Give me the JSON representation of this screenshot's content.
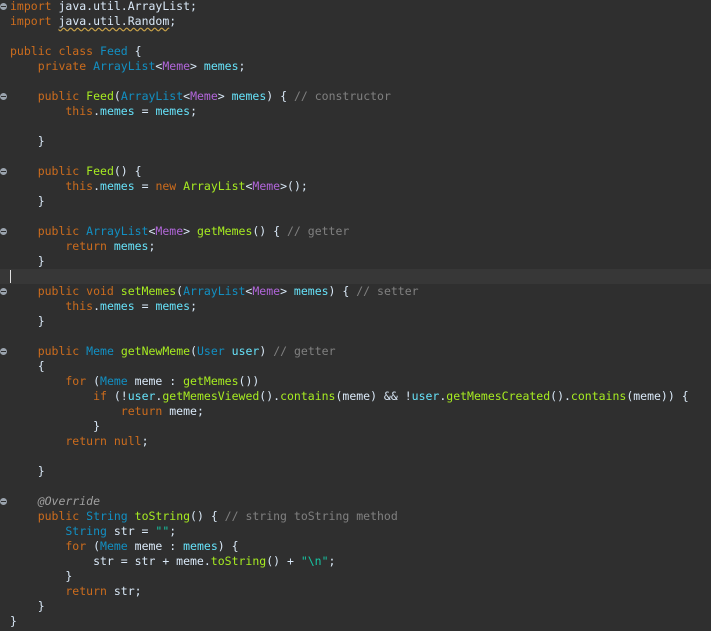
{
  "editor": {
    "language": "java",
    "colors": {
      "background": "#2f2f2f",
      "keyword": "#cc6c1d",
      "class": "#1290c3",
      "generic": "#b166da",
      "method": "#a7ec21",
      "field": "#66e1f8",
      "comment": "#808080",
      "string": "#17c6a3",
      "plain": "#d9e8f7"
    },
    "lines": [
      [
        {
          "t": "import",
          "c": "kw"
        },
        {
          "t": " java.util.ArrayList;",
          "c": "pl"
        }
      ],
      [
        {
          "t": "import",
          "c": "kw"
        },
        {
          "t": " ",
          "c": "pl"
        },
        {
          "t": "java.util.Random",
          "c": "pl squig"
        },
        {
          "t": ";",
          "c": "pl"
        }
      ],
      [],
      [
        {
          "t": "public class ",
          "c": "kw"
        },
        {
          "t": "Feed",
          "c": "cls"
        },
        {
          "t": " {",
          "c": "pl"
        }
      ],
      [
        {
          "t": "    private ",
          "c": "kw"
        },
        {
          "t": "ArrayList",
          "c": "cls"
        },
        {
          "t": "<",
          "c": "pl"
        },
        {
          "t": "Meme",
          "c": "gen"
        },
        {
          "t": "> ",
          "c": "pl"
        },
        {
          "t": "memes",
          "c": "fld"
        },
        {
          "t": ";",
          "c": "pl"
        }
      ],
      [],
      [
        {
          "t": "    public ",
          "c": "kw"
        },
        {
          "t": "Feed",
          "c": "mth"
        },
        {
          "t": "(",
          "c": "pl"
        },
        {
          "t": "ArrayList",
          "c": "cls"
        },
        {
          "t": "<",
          "c": "pl"
        },
        {
          "t": "Meme",
          "c": "gen"
        },
        {
          "t": "> ",
          "c": "pl"
        },
        {
          "t": "memes",
          "c": "fld"
        },
        {
          "t": ") { ",
          "c": "pl"
        },
        {
          "t": "// constructor",
          "c": "cmt"
        }
      ],
      [
        {
          "t": "        this",
          "c": "kw"
        },
        {
          "t": ".",
          "c": "pl"
        },
        {
          "t": "memes",
          "c": "fld"
        },
        {
          "t": " = ",
          "c": "pl"
        },
        {
          "t": "memes",
          "c": "fld"
        },
        {
          "t": ";",
          "c": "pl"
        }
      ],
      [],
      [
        {
          "t": "    }",
          "c": "pl"
        }
      ],
      [],
      [
        {
          "t": "    public ",
          "c": "kw"
        },
        {
          "t": "Feed",
          "c": "mth"
        },
        {
          "t": "() {",
          "c": "pl"
        }
      ],
      [
        {
          "t": "        this",
          "c": "kw"
        },
        {
          "t": ".",
          "c": "pl"
        },
        {
          "t": "memes",
          "c": "fld"
        },
        {
          "t": " = ",
          "c": "pl"
        },
        {
          "t": "new ",
          "c": "kw"
        },
        {
          "t": "ArrayList",
          "c": "mth"
        },
        {
          "t": "<",
          "c": "pl"
        },
        {
          "t": "Meme",
          "c": "gen"
        },
        {
          "t": ">();",
          "c": "pl"
        }
      ],
      [
        {
          "t": "    }",
          "c": "pl"
        }
      ],
      [],
      [
        {
          "t": "    public ",
          "c": "kw"
        },
        {
          "t": "ArrayList",
          "c": "cls"
        },
        {
          "t": "<",
          "c": "pl"
        },
        {
          "t": "Meme",
          "c": "gen"
        },
        {
          "t": "> ",
          "c": "pl"
        },
        {
          "t": "getMemes",
          "c": "mth"
        },
        {
          "t": "() { ",
          "c": "pl"
        },
        {
          "t": "// getter",
          "c": "cmt"
        }
      ],
      [
        {
          "t": "        return ",
          "c": "kw"
        },
        {
          "t": "memes",
          "c": "fld"
        },
        {
          "t": ";",
          "c": "pl"
        }
      ],
      [
        {
          "t": "    }",
          "c": "pl"
        }
      ],
      [],
      [
        {
          "t": "    public void ",
          "c": "kw"
        },
        {
          "t": "setMemes",
          "c": "mth"
        },
        {
          "t": "(",
          "c": "pl"
        },
        {
          "t": "ArrayList",
          "c": "cls"
        },
        {
          "t": "<",
          "c": "pl"
        },
        {
          "t": "Meme",
          "c": "gen"
        },
        {
          "t": "> ",
          "c": "pl"
        },
        {
          "t": "memes",
          "c": "fld"
        },
        {
          "t": ") { ",
          "c": "pl"
        },
        {
          "t": "// setter",
          "c": "cmt"
        }
      ],
      [
        {
          "t": "        this",
          "c": "kw"
        },
        {
          "t": ".",
          "c": "pl"
        },
        {
          "t": "memes",
          "c": "fld"
        },
        {
          "t": " = ",
          "c": "pl"
        },
        {
          "t": "memes",
          "c": "fld"
        },
        {
          "t": ";",
          "c": "pl"
        }
      ],
      [
        {
          "t": "    }",
          "c": "pl"
        }
      ],
      [],
      [
        {
          "t": "    public ",
          "c": "kw"
        },
        {
          "t": "Meme",
          "c": "cls"
        },
        {
          "t": " ",
          "c": "pl"
        },
        {
          "t": "getNewMeme",
          "c": "mth"
        },
        {
          "t": "(",
          "c": "pl"
        },
        {
          "t": "User",
          "c": "cls"
        },
        {
          "t": " ",
          "c": "pl"
        },
        {
          "t": "user",
          "c": "fld"
        },
        {
          "t": ") ",
          "c": "pl"
        },
        {
          "t": "// getter",
          "c": "cmt"
        }
      ],
      [
        {
          "t": "    {",
          "c": "pl"
        }
      ],
      [
        {
          "t": "        for ",
          "c": "kw"
        },
        {
          "t": "(",
          "c": "pl"
        },
        {
          "t": "Meme",
          "c": "cls"
        },
        {
          "t": " meme : ",
          "c": "pl"
        },
        {
          "t": "getMemes",
          "c": "mth"
        },
        {
          "t": "())",
          "c": "pl"
        }
      ],
      [
        {
          "t": "            if ",
          "c": "kw"
        },
        {
          "t": "(!",
          "c": "pl"
        },
        {
          "t": "user",
          "c": "fld"
        },
        {
          "t": ".",
          "c": "pl"
        },
        {
          "t": "getMemesViewed",
          "c": "mth"
        },
        {
          "t": "().",
          "c": "pl"
        },
        {
          "t": "contains",
          "c": "mth"
        },
        {
          "t": "(meme) && !",
          "c": "pl"
        },
        {
          "t": "user",
          "c": "fld"
        },
        {
          "t": ".",
          "c": "pl"
        },
        {
          "t": "getMemesCreated",
          "c": "mth"
        },
        {
          "t": "().",
          "c": "pl"
        },
        {
          "t": "contains",
          "c": "mth"
        },
        {
          "t": "(meme)) {",
          "c": "pl"
        }
      ],
      [
        {
          "t": "                return ",
          "c": "kw"
        },
        {
          "t": "meme;",
          "c": "pl"
        }
      ],
      [
        {
          "t": "            }",
          "c": "pl"
        }
      ],
      [
        {
          "t": "        return null",
          "c": "kw"
        },
        {
          "t": ";",
          "c": "pl"
        }
      ],
      [],
      [
        {
          "t": "    }",
          "c": "pl"
        }
      ],
      [],
      [
        {
          "t": "    @Override",
          "c": "ann"
        }
      ],
      [
        {
          "t": "    public ",
          "c": "kw"
        },
        {
          "t": "String",
          "c": "cls"
        },
        {
          "t": " ",
          "c": "pl"
        },
        {
          "t": "toString",
          "c": "mth"
        },
        {
          "t": "() { ",
          "c": "pl"
        },
        {
          "t": "// string toString method",
          "c": "cmt"
        }
      ],
      [
        {
          "t": "        String",
          "c": "cls"
        },
        {
          "t": " str = ",
          "c": "pl"
        },
        {
          "t": "\"\"",
          "c": "str"
        },
        {
          "t": ";",
          "c": "pl"
        }
      ],
      [
        {
          "t": "        for ",
          "c": "kw"
        },
        {
          "t": "(",
          "c": "pl"
        },
        {
          "t": "Meme",
          "c": "cls"
        },
        {
          "t": " meme : ",
          "c": "pl"
        },
        {
          "t": "memes",
          "c": "fld"
        },
        {
          "t": ") {",
          "c": "pl"
        }
      ],
      [
        {
          "t": "            str = str + meme.",
          "c": "pl"
        },
        {
          "t": "toString",
          "c": "mth"
        },
        {
          "t": "() + ",
          "c": "pl"
        },
        {
          "t": "\"\\n\"",
          "c": "str"
        },
        {
          "t": ";",
          "c": "pl"
        }
      ],
      [
        {
          "t": "        }",
          "c": "pl"
        }
      ],
      [
        {
          "t": "        return ",
          "c": "kw"
        },
        {
          "t": "str;",
          "c": "pl"
        }
      ],
      [
        {
          "t": "    }",
          "c": "pl"
        }
      ],
      [
        {
          "t": "}",
          "c": "pl"
        }
      ]
    ]
  }
}
